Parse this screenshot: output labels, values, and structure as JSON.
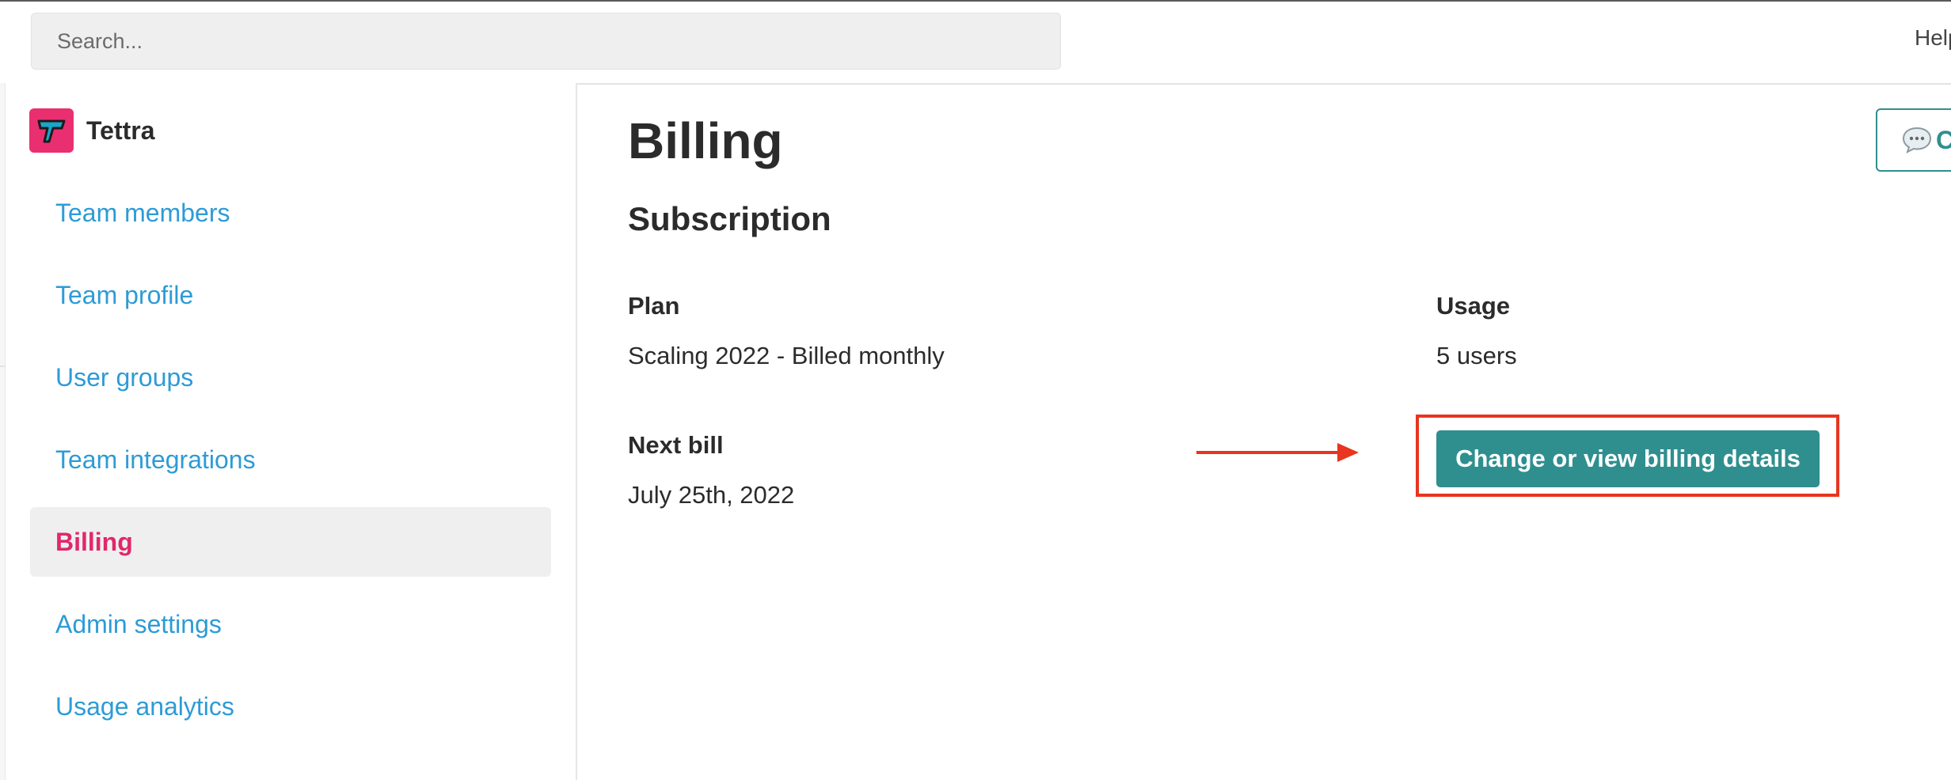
{
  "header": {
    "search_placeholder": "Search...",
    "help_label": "Help"
  },
  "sidebar": {
    "brand_name": "Tettra",
    "brand_color": "#ea2f71",
    "items": [
      {
        "label": "Team members"
      },
      {
        "label": "Team profile"
      },
      {
        "label": "User groups"
      },
      {
        "label": "Team integrations"
      },
      {
        "label": "Billing",
        "active": true
      },
      {
        "label": "Admin settings"
      },
      {
        "label": "Usage analytics"
      }
    ]
  },
  "main": {
    "title": "Billing",
    "section_title": "Subscription",
    "plan_label": "Plan",
    "plan_value": "Scaling 2022 - Billed monthly",
    "usage_label": "Usage",
    "usage_value": "5 users",
    "next_bill_label": "Next bill",
    "next_bill_value": "July 25th, 2022",
    "billing_button_label": "Change or view billing details",
    "chat_button_label": "C"
  },
  "annotation": {
    "color": "#e8351f"
  },
  "colors": {
    "accent_teal": "#2f8f8f",
    "link_blue": "#2d9bd6",
    "active_pink": "#e0286a"
  }
}
